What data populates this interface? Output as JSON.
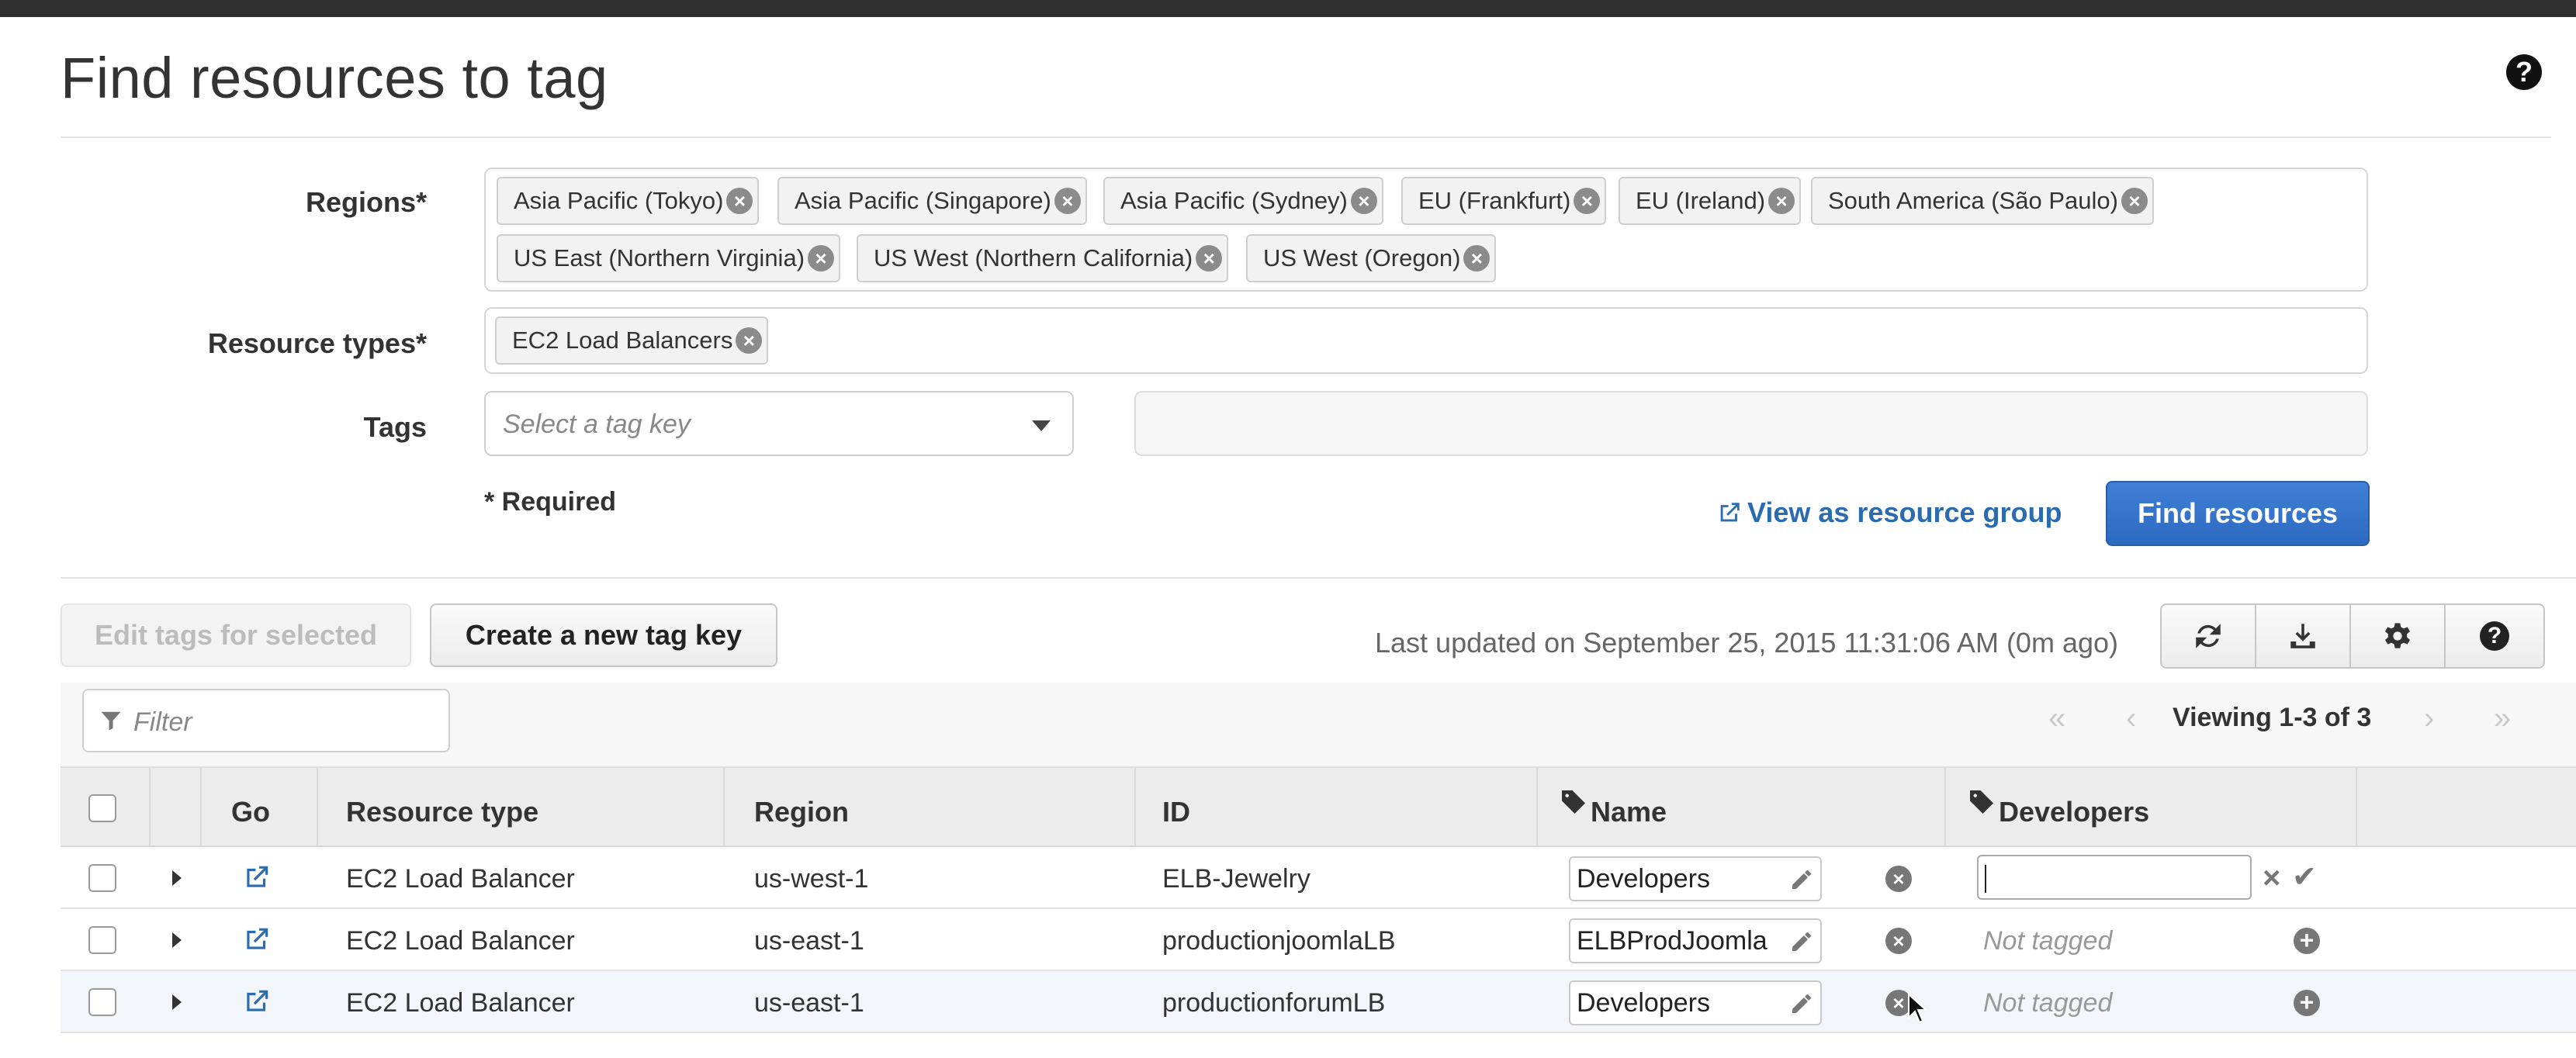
{
  "page": {
    "title": "Find resources to tag"
  },
  "form": {
    "regions_label": "Regions*",
    "regions": [
      "Asia Pacific (Tokyo)",
      "Asia Pacific (Singapore)",
      "Asia Pacific (Sydney)",
      "EU (Frankfurt)",
      "EU (Ireland)",
      "South America (São Paulo)",
      "US East (Northern Virginia)",
      "US West (Northern California)",
      "US West (Oregon)"
    ],
    "resource_types_label": "Resource types*",
    "resource_types": [
      "EC2 Load Balancers"
    ],
    "tags_label": "Tags",
    "tag_key_placeholder": "Select a tag key",
    "required_note": "* Required",
    "view_group_label": "View as resource group",
    "find_button_label": "Find resources"
  },
  "toolbar": {
    "edit_selected_label": "Edit tags for selected",
    "create_tag_key_label": "Create a new tag key",
    "last_updated": "Last updated on September 25, 2015 11:31:06 AM (0m ago)",
    "icons": [
      "refresh-icon",
      "download-icon",
      "gear-icon",
      "help-icon"
    ]
  },
  "filter": {
    "placeholder": "Filter"
  },
  "pagination": {
    "first": "«",
    "prev": "‹",
    "text": "Viewing 1-3 of 3",
    "next": "›",
    "last": "»"
  },
  "table": {
    "columns": [
      "Go",
      "Resource type",
      "Region",
      "ID",
      "Name",
      "Developers"
    ],
    "rows": [
      {
        "resource_type": "EC2 Load Balancer",
        "region": "us-west-1",
        "id": "ELB-Jewelry",
        "name": "Developers",
        "developers": ""
      },
      {
        "resource_type": "EC2 Load Balancer",
        "region": "us-east-1",
        "id": "productionjoomlaLB",
        "name": "ELBProdJoomla",
        "developers": "Not tagged"
      },
      {
        "resource_type": "EC2 Load Balancer",
        "region": "us-east-1",
        "id": "productionforumLB",
        "name": "Developers",
        "developers": "Not tagged"
      }
    ]
  },
  "colors": {
    "primary": "#2d6ac1",
    "link": "#2b6cb0",
    "topbar": "#2f2f2f"
  }
}
